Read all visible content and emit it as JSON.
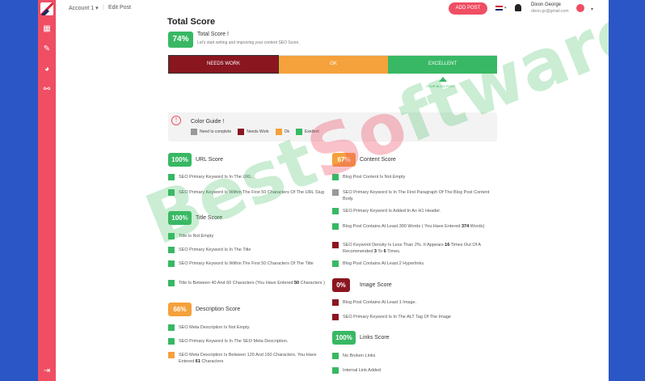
{
  "topbar": {
    "account": "Account 1 ▾",
    "page": "Edit Post",
    "add_post": "ADD POST",
    "lang": "▾",
    "user_name": "Dixon George",
    "user_email": "dixon.gx@gmail.com"
  },
  "score": {
    "heading": "Total Score",
    "total_badge": "74%",
    "total_title": "Total Score !",
    "total_sub": "Let's start writing and improving your content SEO Score.",
    "bar": [
      "NEEDS WORK",
      "OK",
      "EXCELLENT"
    ],
    "pointer_label": "YOUR BLOG POST"
  },
  "guide": {
    "title": "Color Guide !",
    "items": [
      "Need to complete",
      "Needs Work",
      "Ok",
      "Exellent"
    ]
  },
  "left": {
    "url": {
      "badge": "100%",
      "title": "URL Score",
      "items": [
        "SEO Primary Keyword Is In The URL.",
        "SEO Primary Keyword Is Within The First 50 Characters Of The URL Slug"
      ]
    },
    "title": {
      "badge": "100%",
      "title": "Title Score",
      "items": [
        "Title Is Not Empty",
        "SEO Primary Keyword Is In The Title",
        "SEO Primary Keyword Is Within The First 50 Characters Of The Title",
        "Title Is Between 40 And 60 Characters (You Have Entered 50 Characters )"
      ]
    },
    "desc": {
      "badge": "66%",
      "title": "Description Score",
      "items": [
        "SEO Meta Description Is Not Empty.",
        "SEO Primary Keyword Is In The SEO Meta Description.",
        "SEO Meta Description Is Between 120 And 160 Characters. You Have Entered 61 Characters"
      ]
    }
  },
  "right": {
    "content": {
      "badge": "67%",
      "title": "Content Score",
      "items": [
        "Blog Post Content Is Not Empty",
        "SEO Primary Keyword Is In The First Paragraph Of The Blog Post Content Body.",
        "SEO Primary Keyword Is Added In An H1 Header.",
        "Blog Post Contains At Least 300 Words ( You Have Entered 374 Words)",
        "SEO Keyword Density Is Less Than 2%. It Appears 16 Times Out Of A Recommended 3 To 6 Times.",
        "Blog Post Contains At Least 2 Hyperlinks."
      ]
    },
    "image": {
      "badge": "0%",
      "title": "Image Score",
      "items": [
        "Blog Post Contains At Least 1 Image.",
        "SEO Primary Keyword Is In The ALT Tag Of The Image"
      ]
    },
    "links": {
      "badge": "100%",
      "title": "Links Score",
      "items": [
        "No Broken Links",
        "Internal Link Added"
      ]
    }
  },
  "watermark": {
    "part1": "Best",
    "part2": "So",
    "part3": "ftware"
  },
  "colors": {
    "accent": "#ef4e63",
    "green": "#38b864",
    "orange": "#f5a13c",
    "red": "#8a1620",
    "frame_blue": "#2b56c6"
  }
}
